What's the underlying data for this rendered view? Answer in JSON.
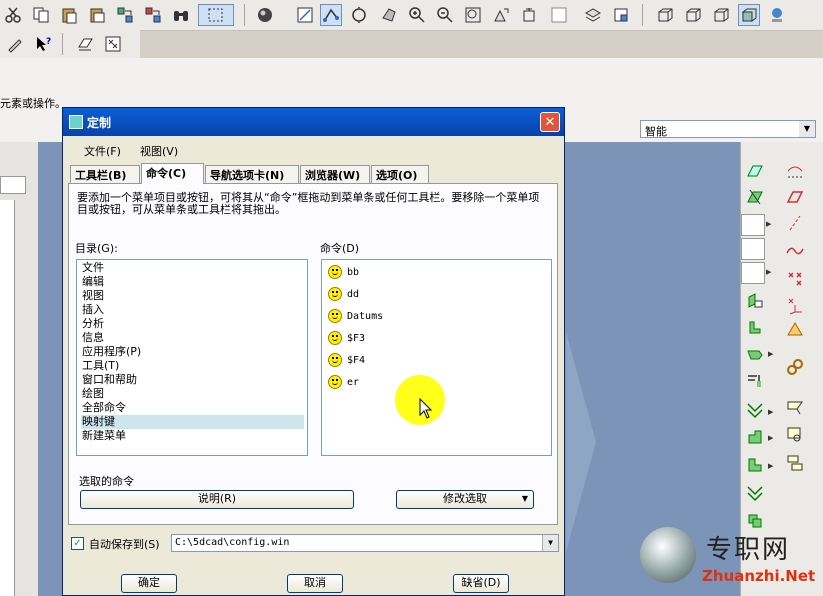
{
  "message": "元素或操作。",
  "filter": {
    "value": "智能"
  },
  "dialog": {
    "title": "定制",
    "menu": {
      "file": "文件(F)",
      "view": "视图(V)"
    },
    "tabs": [
      "工具栏(B)",
      "命令(C)",
      "导航选项卡(N)",
      "浏览器(W)",
      "选项(O)"
    ],
    "active_tab": "命令(C)",
    "description": "要添加一个菜单项目或按钮，可将其从“命令”框拖动到菜单条或任何工具栏。要移除一个菜单项目或按钮，可从菜单条或工具栏将其拖出。",
    "directory_label": "目录(G):",
    "commands_label": "命令(D)",
    "directory_items": [
      "文件",
      "编辑",
      "视图",
      "插入",
      "分析",
      "信息",
      "应用程序(P)",
      "工具(T)",
      "窗口和帮助",
      "绘图",
      "全部命令",
      "映射键",
      "新建菜单"
    ],
    "selected_directory": "映射键",
    "command_items": [
      "bb",
      "dd",
      "Datums",
      "$F3",
      "$F4",
      "er"
    ],
    "selected_command_label": "选取的命令",
    "explain_button": "说明(R)",
    "modify_button": "修改选取",
    "autosave_label": "自动保存到(S)",
    "autosave_checked": true,
    "autosave_path": "C:\\5dcad\\config.win",
    "ok_button": "确定",
    "cancel_button": "取消",
    "default_button": "缺省(D)"
  },
  "watermark": {
    "text": "专职网",
    "url": "Zhuanzhi.Net"
  },
  "colors": {
    "graphics_bg": "#7b94b8",
    "title_bar": "#0842a8",
    "accent_yellow": "#ffff00"
  }
}
